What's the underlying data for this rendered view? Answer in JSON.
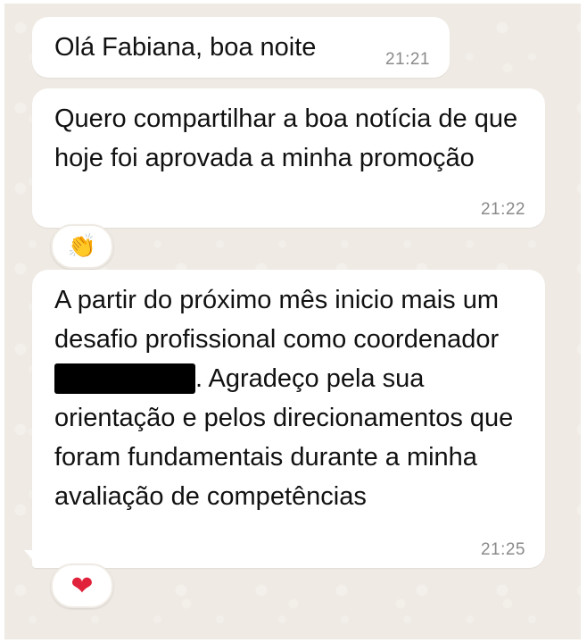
{
  "messages": [
    {
      "text": "Olá Fabiana, boa noite",
      "time": "21:21"
    },
    {
      "text": "Quero compartilhar a boa notícia de que hoje foi aprovada a minha promoção",
      "time": "21:22",
      "reaction": "👏"
    },
    {
      "text_before_redaction": "A partir do próximo mês inicio mais um desafio profissional como coordenador ",
      "text_after_redaction": ". Agradeço pela sua orientação e pelos direcionamentos que foram fundamentais durante a minha avaliação de competências",
      "time": "21:25",
      "reaction": "❤"
    }
  ],
  "colors": {
    "chat_background": "#efeae3",
    "bubble": "#ffffff",
    "timestamp": "#8a8a8a",
    "heart": "#e0223a"
  },
  "icons": {
    "reaction_1": "clapping-hands-icon",
    "reaction_2": "red-heart-icon"
  }
}
